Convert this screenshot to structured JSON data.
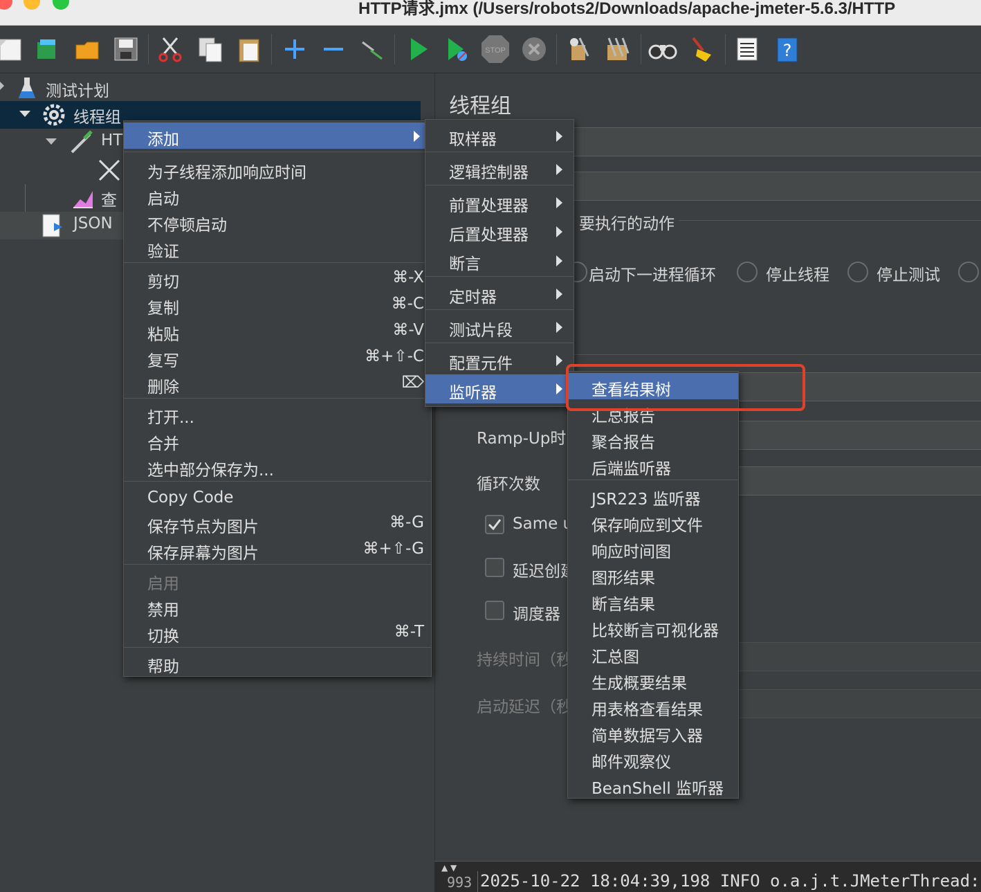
{
  "window": {
    "title": "HTTP请求.jmx (/Users/robots2/Downloads/apache-jmeter-5.6.3/HTTP"
  },
  "toolbar": {
    "icons": [
      "new-icon",
      "templates-icon",
      "open-icon",
      "save-icon",
      "cut-icon",
      "copy-icon",
      "paste-icon",
      "expand-icon",
      "collapse-icon",
      "toggle-icon",
      "start-icon",
      "start-no-pause-icon",
      "stop-icon",
      "shutdown-icon",
      "clear-icon",
      "clear-all-icon",
      "search-icon",
      "reset-search-icon",
      "function-helper-icon",
      "help-icon"
    ]
  },
  "tree": {
    "items": [
      {
        "label": "测试计划"
      },
      {
        "label": "线程组"
      },
      {
        "label": "HT"
      },
      {
        "label": ""
      },
      {
        "label": "查"
      },
      {
        "label": "JSON"
      }
    ]
  },
  "panel": {
    "title": "线程组",
    "error_action_label": "要执行的动作",
    "radios": [
      "启动下一进程循环",
      "停止线程",
      "停止测试"
    ],
    "rampup_label": "Ramp-Up时",
    "loop_label": "循环次数",
    "same_user_label": "Same u",
    "delay_label": "延迟创建",
    "scheduler_label": "调度器",
    "duration_label": "持续时间（秒",
    "startup_delay_label": "启动延迟（秒"
  },
  "context_menu": {
    "items": [
      {
        "label": "添加",
        "shortcut": ""
      },
      {
        "label": "为子线程添加响应时间",
        "shortcut": ""
      },
      {
        "label": "启动",
        "shortcut": ""
      },
      {
        "label": "不停顿启动",
        "shortcut": ""
      },
      {
        "label": "验证",
        "shortcut": ""
      },
      {
        "label": "剪切",
        "shortcut": "⌘-X"
      },
      {
        "label": "复制",
        "shortcut": "⌘-C"
      },
      {
        "label": "粘贴",
        "shortcut": "⌘-V"
      },
      {
        "label": "复写",
        "shortcut": "⌘+⇧-C"
      },
      {
        "label": "删除",
        "shortcut": "⌦"
      },
      {
        "label": "打开...",
        "shortcut": ""
      },
      {
        "label": "合并",
        "shortcut": ""
      },
      {
        "label": "选中部分保存为...",
        "shortcut": ""
      },
      {
        "label": "Copy Code",
        "shortcut": ""
      },
      {
        "label": "保存节点为图片",
        "shortcut": "⌘-G"
      },
      {
        "label": "保存屏幕为图片",
        "shortcut": "⌘+⇧-G"
      },
      {
        "label": "启用",
        "shortcut": ""
      },
      {
        "label": "禁用",
        "shortcut": ""
      },
      {
        "label": "切换",
        "shortcut": "⌘-T"
      },
      {
        "label": "帮助",
        "shortcut": ""
      }
    ]
  },
  "add_submenu": {
    "items": [
      "取样器",
      "逻辑控制器",
      "前置处理器",
      "后置处理器",
      "断言",
      "定时器",
      "测试片段",
      "配置元件",
      "监听器"
    ]
  },
  "listener_submenu": {
    "items": [
      "查看结果树",
      "汇总报告",
      "聚合报告",
      "后端监听器",
      "JSR223 监听器",
      "保存响应到文件",
      "响应时间图",
      "图形结果",
      "断言结果",
      "比较断言可视化器",
      "汇总图",
      "生成概要结果",
      "用表格查看结果",
      "简单数据写入器",
      "邮件观察仪",
      "BeanShell 监听器"
    ]
  },
  "log": {
    "line_no": "993",
    "text": "2025-10-22 18:04:39,198 INFO o.a.j.t.JMeterThread: T"
  },
  "colors": {
    "highlight": "#4b6eaf",
    "annotation": "#e0412a",
    "background": "#3c3f41"
  }
}
